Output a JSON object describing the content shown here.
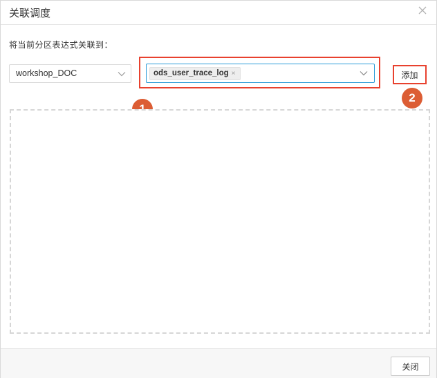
{
  "dialog": {
    "title": "关联调度",
    "close_icon": "close-icon"
  },
  "form": {
    "hint": "将当前分区表达式关联到：",
    "workspace_select": {
      "value": "workshop_DOC",
      "icon": "chevron-down-icon"
    },
    "table_select": {
      "tags": [
        {
          "label": "ods_user_trace_log",
          "remove_glyph": "×"
        }
      ],
      "icon": "chevron-down-icon"
    },
    "add_label": "添加"
  },
  "annotations": {
    "step1": "1",
    "step2": "2",
    "highlight_color": "#e8412e",
    "badge_color": "#dc5d34"
  },
  "footer": {
    "close_label": "关闭"
  }
}
